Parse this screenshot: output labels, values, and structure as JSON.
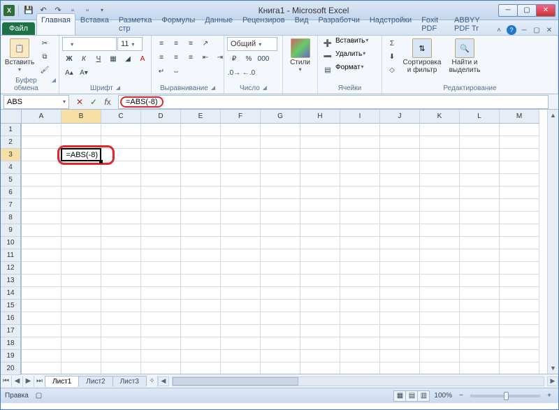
{
  "title_bar": {
    "app_title": "Книга1 - Microsoft Excel"
  },
  "tabs": {
    "file": "Файл",
    "items": [
      "Главная",
      "Вставка",
      "Разметка стр",
      "Формулы",
      "Данные",
      "Рецензиров",
      "Вид",
      "Разработчи",
      "Надстройки",
      "Foxit PDF",
      "ABBYY PDF Tr"
    ],
    "active_index": 0
  },
  "ribbon": {
    "clipboard": {
      "label": "Буфер обмена",
      "paste": "Вставить"
    },
    "font": {
      "label": "Шрифт",
      "size": "11"
    },
    "alignment": {
      "label": "Выравнивание"
    },
    "number": {
      "label": "Число",
      "format": "Общий"
    },
    "styles": {
      "label": "Стили",
      "btn": "Стили"
    },
    "cells": {
      "label": "Ячейки",
      "insert": "Вставить",
      "delete": "Удалить",
      "format": "Формат"
    },
    "editing": {
      "label": "Редактирование",
      "sort": "Сортировка и фильтр",
      "find": "Найти и выделить"
    }
  },
  "formula_bar": {
    "name_box": "ABS",
    "formula": "=ABS(-8)"
  },
  "grid": {
    "columns": [
      "A",
      "B",
      "C",
      "D",
      "E",
      "F",
      "G",
      "H",
      "I",
      "J",
      "K",
      "L",
      "M"
    ],
    "row_count": 20,
    "active_cell": {
      "col": 1,
      "row": 2,
      "display": "=ABS(-8)"
    },
    "active_col_label": "B",
    "active_row_label": "3"
  },
  "sheets": {
    "items": [
      "Лист1",
      "Лист2",
      "Лист3"
    ],
    "active_index": 0
  },
  "status": {
    "mode": "Правка",
    "zoom": "100%"
  }
}
